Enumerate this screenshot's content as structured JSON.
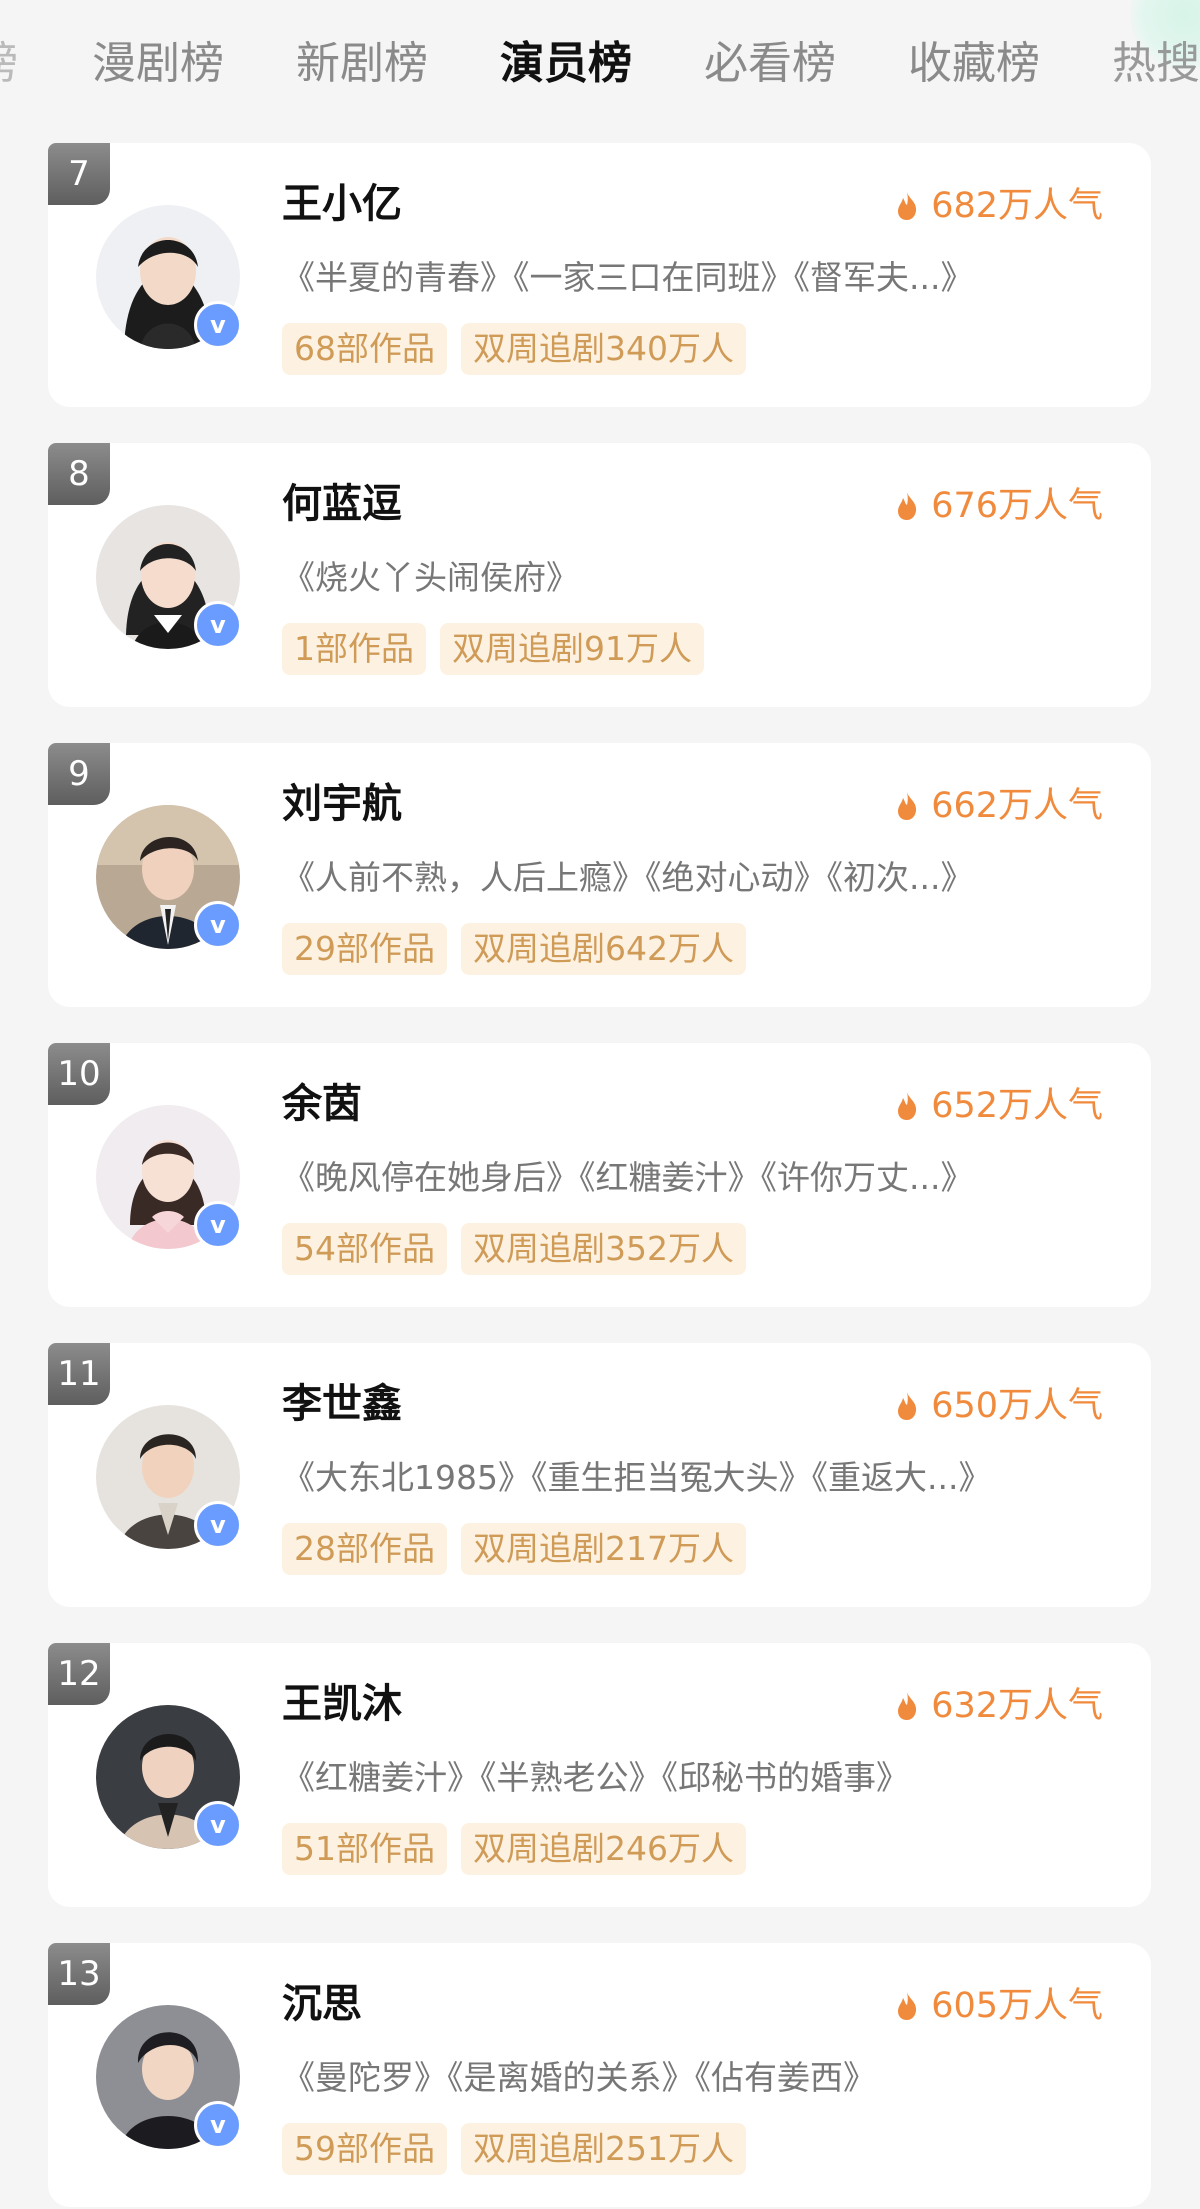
{
  "tabs": [
    {
      "label": "榜",
      "active": false
    },
    {
      "label": "漫剧榜",
      "active": false
    },
    {
      "label": "新剧榜",
      "active": false
    },
    {
      "label": "演员榜",
      "active": true
    },
    {
      "label": "必看榜",
      "active": false
    },
    {
      "label": "收藏榜",
      "active": false
    },
    {
      "label": "热搜",
      "active": false
    }
  ],
  "actors": [
    {
      "rank": "7",
      "name": "王小亿",
      "heat": "682万人气",
      "works": "《半夏的青春》《一家三口在同班》《督军夫...》",
      "count": "68部作品",
      "followers": "双周追剧340万人",
      "verified_label": "v"
    },
    {
      "rank": "8",
      "name": "何蓝逗",
      "heat": "676万人气",
      "works": "《烧火丫头闹侯府》",
      "count": "1部作品",
      "followers": "双周追剧91万人",
      "verified_label": "v"
    },
    {
      "rank": "9",
      "name": "刘宇航",
      "heat": "662万人气",
      "works": "《人前不熟，人后上瘾》《绝对心动》《初次...》",
      "count": "29部作品",
      "followers": "双周追剧642万人",
      "verified_label": "v"
    },
    {
      "rank": "10",
      "name": "余茵",
      "heat": "652万人气",
      "works": "《晚风停在她身后》《红糖姜汁》《许你万丈...》",
      "count": "54部作品",
      "followers": "双周追剧352万人",
      "verified_label": "v"
    },
    {
      "rank": "11",
      "name": "李世鑫",
      "heat": "650万人气",
      "works": "《大东北1985》《重生拒当冤大头》《重返大...》",
      "count": "28部作品",
      "followers": "双周追剧217万人",
      "verified_label": "v"
    },
    {
      "rank": "12",
      "name": "王凯沐",
      "heat": "632万人气",
      "works": "《红糖姜汁》《半熟老公》《邱秘书的婚事》",
      "count": "51部作品",
      "followers": "双周追剧246万人",
      "verified_label": "v"
    },
    {
      "rank": "13",
      "name": "沉思",
      "heat": "605万人气",
      "works": "《曼陀罗》《是离婚的关系》《佔有姜西》",
      "count": "59部作品",
      "followers": "双周追剧251万人",
      "verified_label": "v"
    }
  ],
  "colors": {
    "heat": "#f08a3c",
    "tag_text": "#cf9b57",
    "tag_bg": "#fdf2e2",
    "verified": "#6a9cff",
    "active_tab": "#111111",
    "inactive_tab": "#8a8a8a"
  },
  "icons": {
    "heat": "flame-icon",
    "verified": "verified-badge-icon"
  }
}
